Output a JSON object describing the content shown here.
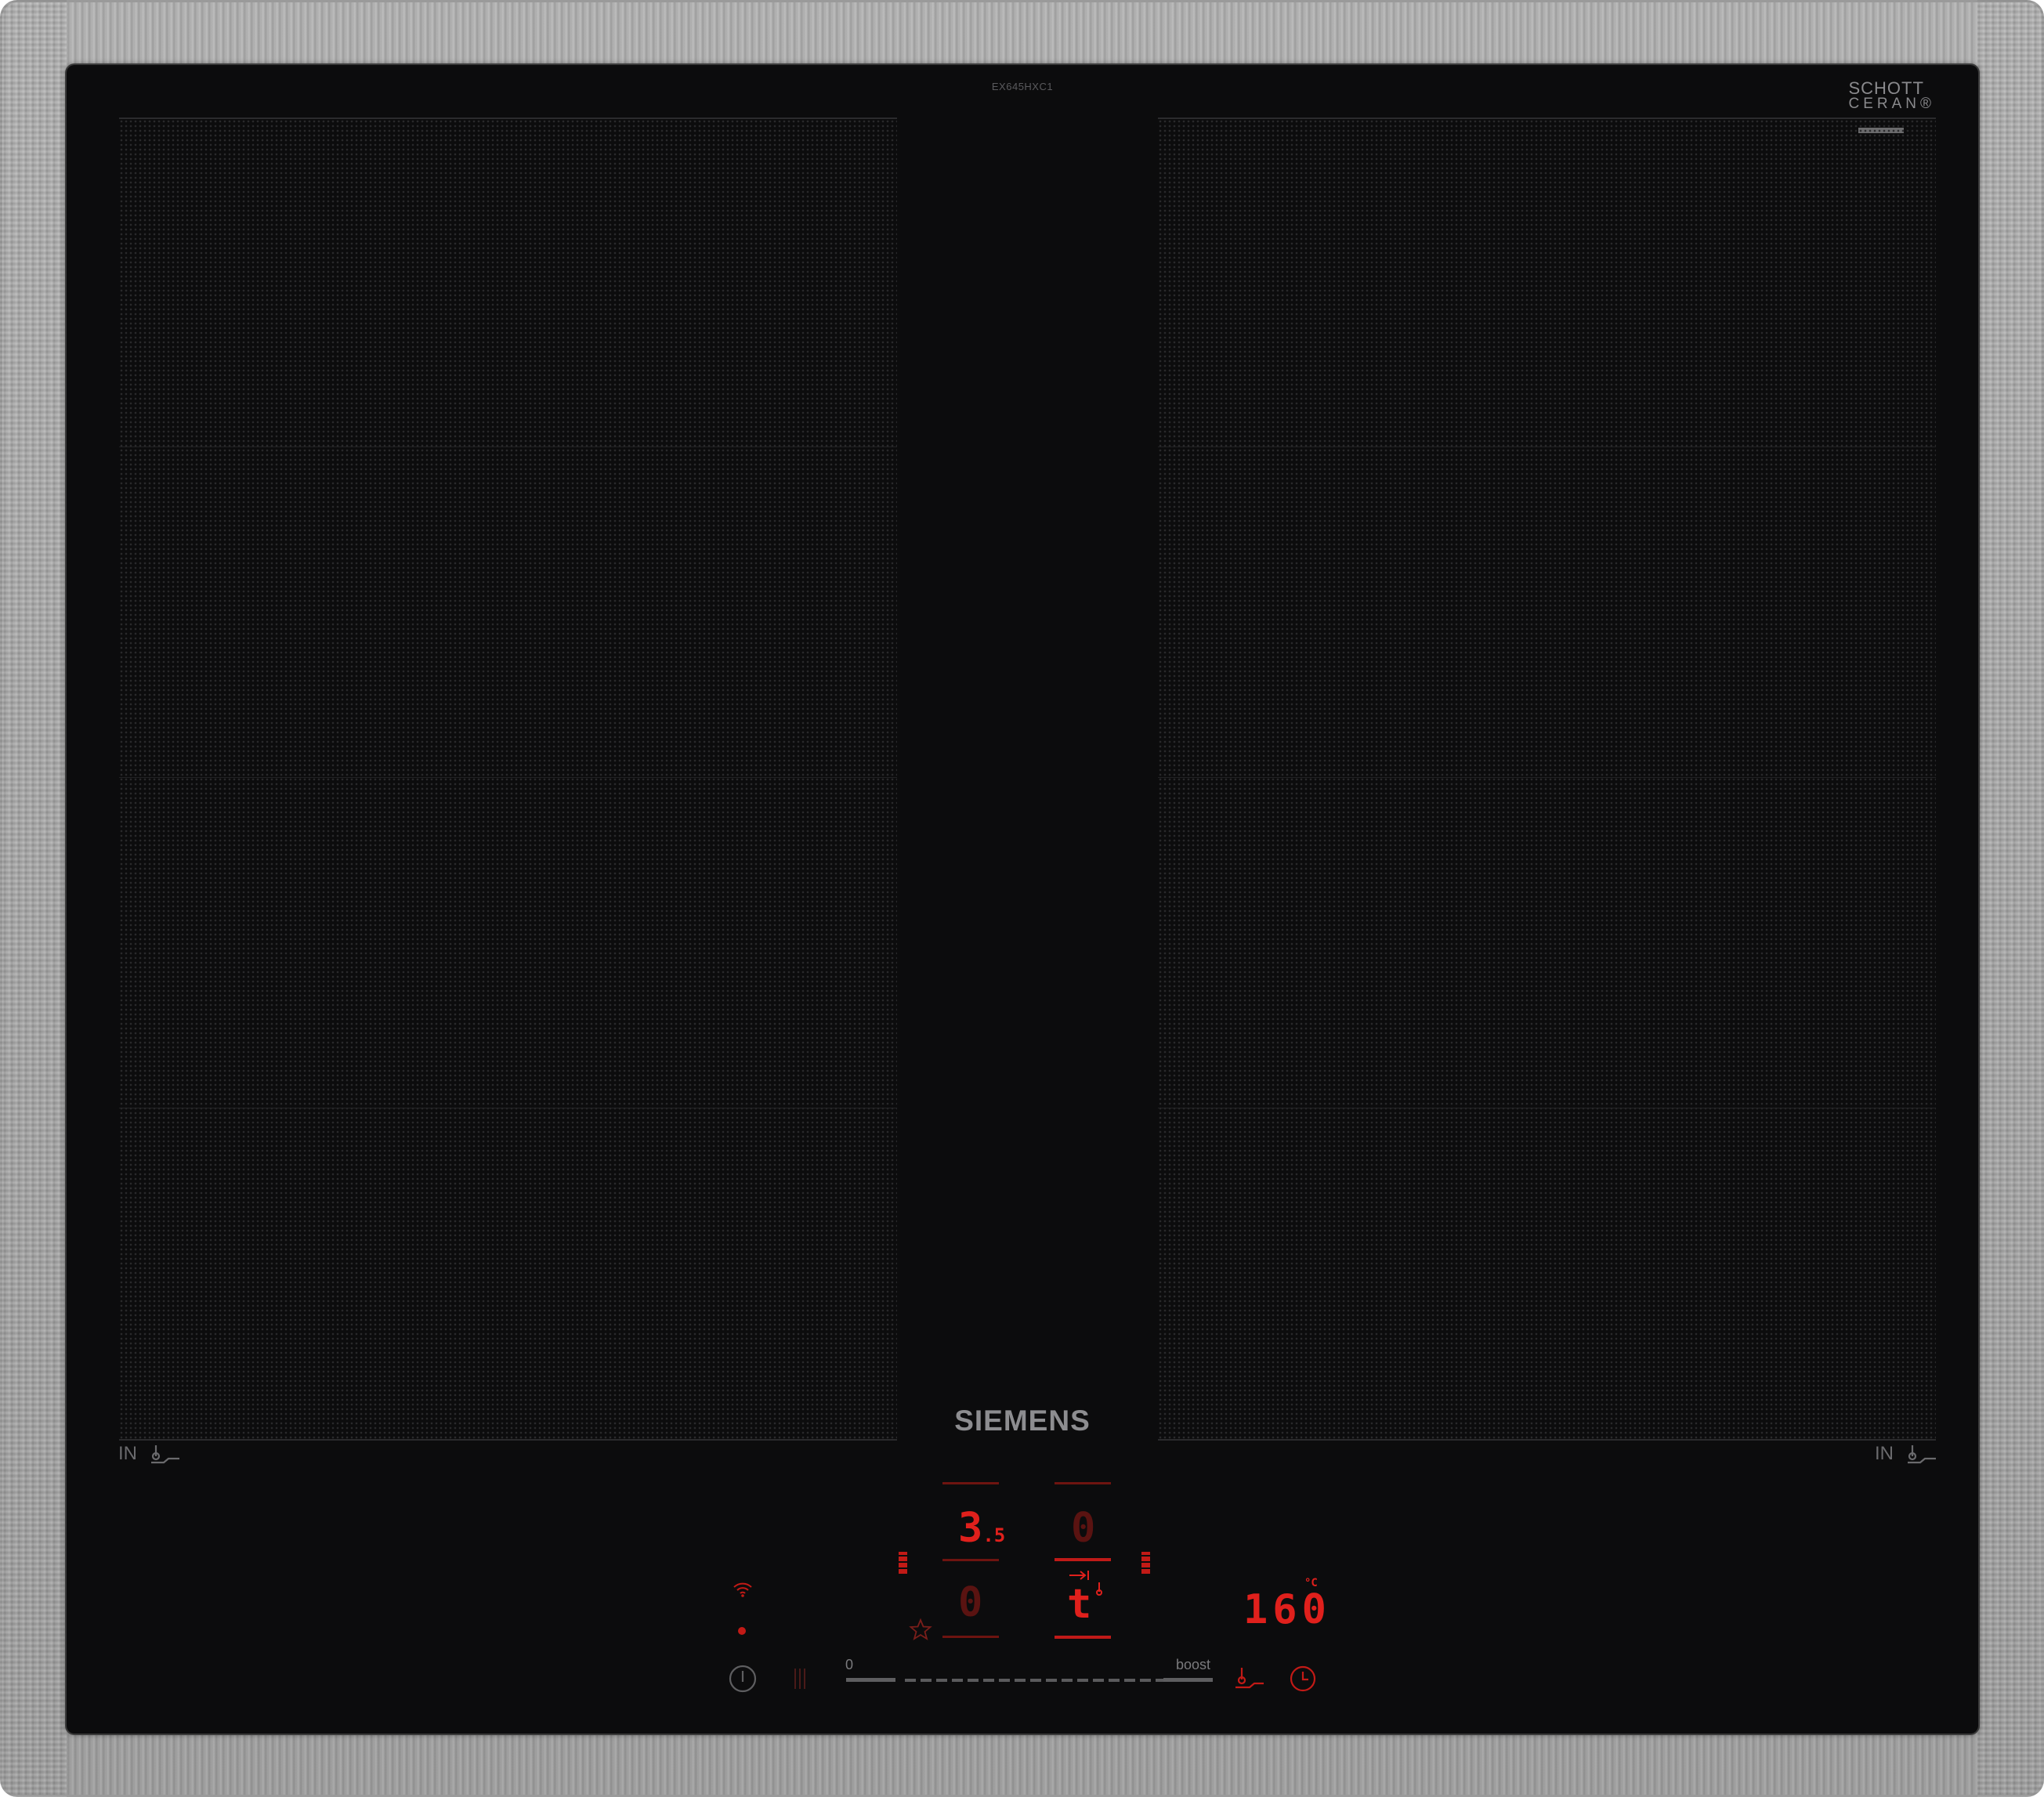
{
  "hob": {
    "model_code": "EX645HXC1",
    "brand": "SIEMENS",
    "glass_badge": {
      "line1": "SCHOTT",
      "line2": "CERAN®"
    },
    "zone_labels": {
      "left": "IN",
      "right": "IN"
    }
  },
  "control_panel": {
    "zone_front_left_level": "3",
    "zone_front_left_level_fraction": ".5",
    "zone_front_right_level": "0",
    "zone_rear_left_level": "0",
    "zone_rear_right_level": "t",
    "temperature": "160",
    "temperature_unit": "°C",
    "slider": {
      "min_label": "0",
      "max_label": "boost"
    }
  },
  "colors": {
    "display_red": "#e0201c",
    "glass": "#0c0c0d",
    "frame": "#c8c8c8"
  },
  "icons": [
    "wifi-icon",
    "status-dot-icon",
    "favorite-star-icon",
    "power-icon",
    "child-lock-icon",
    "frying-sensor-icon",
    "timer-clock-icon",
    "cooking-sensor-icon",
    "move-function-icon",
    "zone-select-icon"
  ]
}
